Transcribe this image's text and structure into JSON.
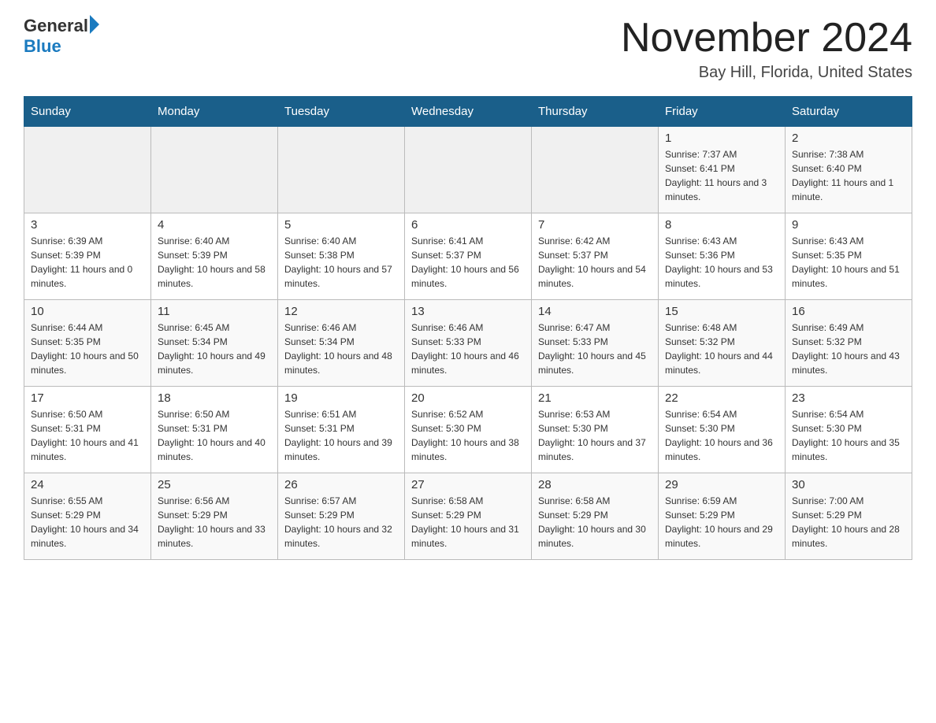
{
  "header": {
    "logo_general": "General",
    "logo_blue": "Blue",
    "title": "November 2024",
    "subtitle": "Bay Hill, Florida, United States"
  },
  "days_of_week": [
    "Sunday",
    "Monday",
    "Tuesday",
    "Wednesday",
    "Thursday",
    "Friday",
    "Saturday"
  ],
  "weeks": [
    [
      {
        "day": "",
        "info": ""
      },
      {
        "day": "",
        "info": ""
      },
      {
        "day": "",
        "info": ""
      },
      {
        "day": "",
        "info": ""
      },
      {
        "day": "",
        "info": ""
      },
      {
        "day": "1",
        "info": "Sunrise: 7:37 AM\nSunset: 6:41 PM\nDaylight: 11 hours and 3 minutes."
      },
      {
        "day": "2",
        "info": "Sunrise: 7:38 AM\nSunset: 6:40 PM\nDaylight: 11 hours and 1 minute."
      }
    ],
    [
      {
        "day": "3",
        "info": "Sunrise: 6:39 AM\nSunset: 5:39 PM\nDaylight: 11 hours and 0 minutes."
      },
      {
        "day": "4",
        "info": "Sunrise: 6:40 AM\nSunset: 5:39 PM\nDaylight: 10 hours and 58 minutes."
      },
      {
        "day": "5",
        "info": "Sunrise: 6:40 AM\nSunset: 5:38 PM\nDaylight: 10 hours and 57 minutes."
      },
      {
        "day": "6",
        "info": "Sunrise: 6:41 AM\nSunset: 5:37 PM\nDaylight: 10 hours and 56 minutes."
      },
      {
        "day": "7",
        "info": "Sunrise: 6:42 AM\nSunset: 5:37 PM\nDaylight: 10 hours and 54 minutes."
      },
      {
        "day": "8",
        "info": "Sunrise: 6:43 AM\nSunset: 5:36 PM\nDaylight: 10 hours and 53 minutes."
      },
      {
        "day": "9",
        "info": "Sunrise: 6:43 AM\nSunset: 5:35 PM\nDaylight: 10 hours and 51 minutes."
      }
    ],
    [
      {
        "day": "10",
        "info": "Sunrise: 6:44 AM\nSunset: 5:35 PM\nDaylight: 10 hours and 50 minutes."
      },
      {
        "day": "11",
        "info": "Sunrise: 6:45 AM\nSunset: 5:34 PM\nDaylight: 10 hours and 49 minutes."
      },
      {
        "day": "12",
        "info": "Sunrise: 6:46 AM\nSunset: 5:34 PM\nDaylight: 10 hours and 48 minutes."
      },
      {
        "day": "13",
        "info": "Sunrise: 6:46 AM\nSunset: 5:33 PM\nDaylight: 10 hours and 46 minutes."
      },
      {
        "day": "14",
        "info": "Sunrise: 6:47 AM\nSunset: 5:33 PM\nDaylight: 10 hours and 45 minutes."
      },
      {
        "day": "15",
        "info": "Sunrise: 6:48 AM\nSunset: 5:32 PM\nDaylight: 10 hours and 44 minutes."
      },
      {
        "day": "16",
        "info": "Sunrise: 6:49 AM\nSunset: 5:32 PM\nDaylight: 10 hours and 43 minutes."
      }
    ],
    [
      {
        "day": "17",
        "info": "Sunrise: 6:50 AM\nSunset: 5:31 PM\nDaylight: 10 hours and 41 minutes."
      },
      {
        "day": "18",
        "info": "Sunrise: 6:50 AM\nSunset: 5:31 PM\nDaylight: 10 hours and 40 minutes."
      },
      {
        "day": "19",
        "info": "Sunrise: 6:51 AM\nSunset: 5:31 PM\nDaylight: 10 hours and 39 minutes."
      },
      {
        "day": "20",
        "info": "Sunrise: 6:52 AM\nSunset: 5:30 PM\nDaylight: 10 hours and 38 minutes."
      },
      {
        "day": "21",
        "info": "Sunrise: 6:53 AM\nSunset: 5:30 PM\nDaylight: 10 hours and 37 minutes."
      },
      {
        "day": "22",
        "info": "Sunrise: 6:54 AM\nSunset: 5:30 PM\nDaylight: 10 hours and 36 minutes."
      },
      {
        "day": "23",
        "info": "Sunrise: 6:54 AM\nSunset: 5:30 PM\nDaylight: 10 hours and 35 minutes."
      }
    ],
    [
      {
        "day": "24",
        "info": "Sunrise: 6:55 AM\nSunset: 5:29 PM\nDaylight: 10 hours and 34 minutes."
      },
      {
        "day": "25",
        "info": "Sunrise: 6:56 AM\nSunset: 5:29 PM\nDaylight: 10 hours and 33 minutes."
      },
      {
        "day": "26",
        "info": "Sunrise: 6:57 AM\nSunset: 5:29 PM\nDaylight: 10 hours and 32 minutes."
      },
      {
        "day": "27",
        "info": "Sunrise: 6:58 AM\nSunset: 5:29 PM\nDaylight: 10 hours and 31 minutes."
      },
      {
        "day": "28",
        "info": "Sunrise: 6:58 AM\nSunset: 5:29 PM\nDaylight: 10 hours and 30 minutes."
      },
      {
        "day": "29",
        "info": "Sunrise: 6:59 AM\nSunset: 5:29 PM\nDaylight: 10 hours and 29 minutes."
      },
      {
        "day": "30",
        "info": "Sunrise: 7:00 AM\nSunset: 5:29 PM\nDaylight: 10 hours and 28 minutes."
      }
    ]
  ]
}
